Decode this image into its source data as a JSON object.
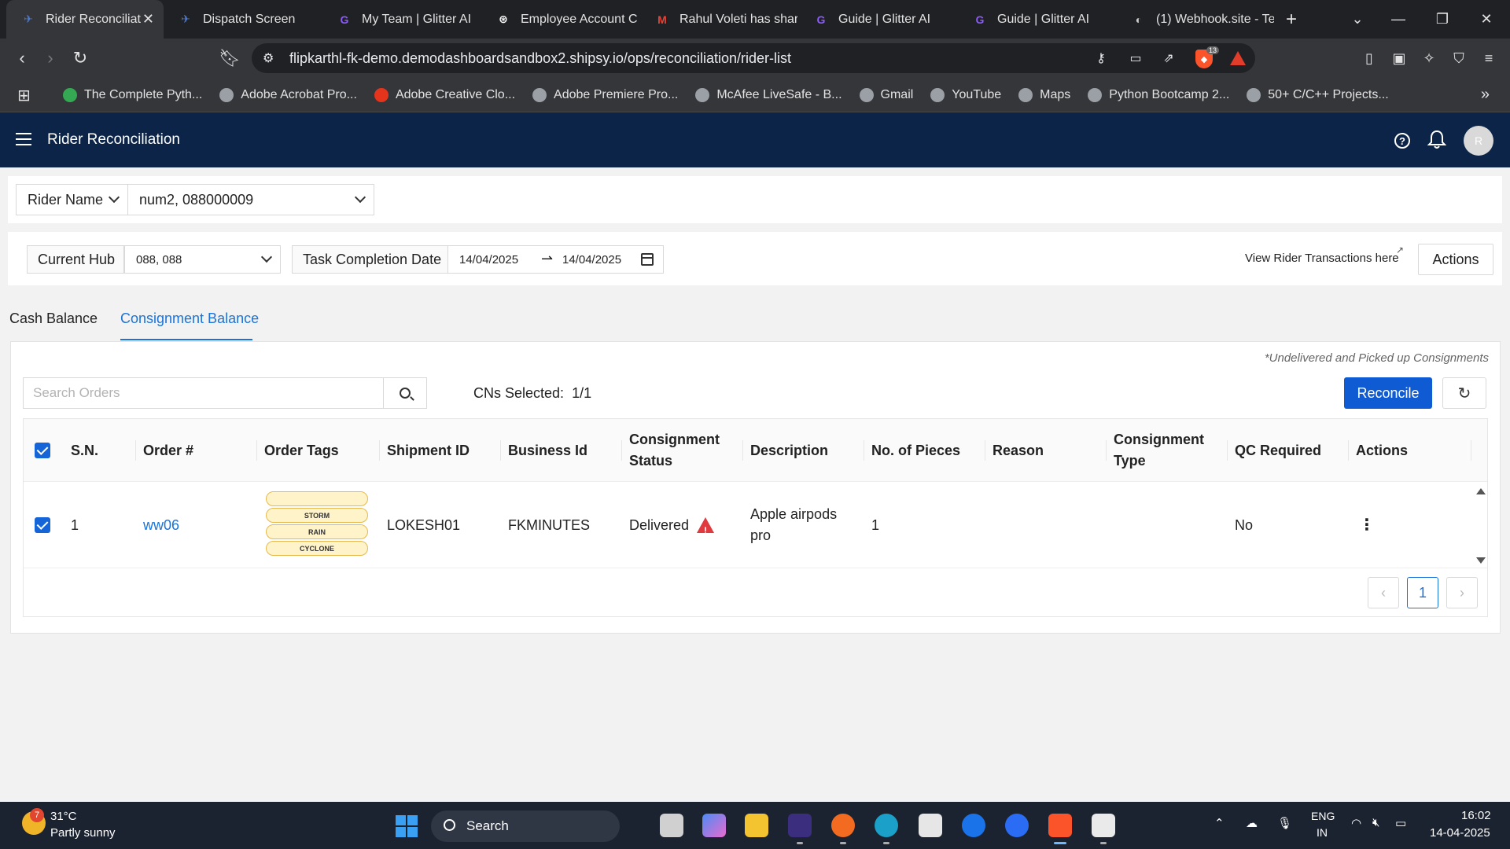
{
  "browser": {
    "tabs": [
      {
        "label": "Rider Reconciliat",
        "icon": "shipsy-icon",
        "active": true
      },
      {
        "label": "Dispatch Screen",
        "icon": "shipsy-icon"
      },
      {
        "label": "My Team | Glitter AI",
        "icon": "glitter-icon"
      },
      {
        "label": "Employee Account C",
        "icon": "chatgpt-icon"
      },
      {
        "label": "Rahul Voleti has shar",
        "icon": "gmail-icon"
      },
      {
        "label": "Guide | Glitter AI",
        "icon": "glitter-icon"
      },
      {
        "label": "Guide | Glitter AI",
        "icon": "glitter-icon"
      },
      {
        "label": "(1) Webhook.site - Te",
        "icon": "webhook-icon"
      }
    ],
    "url": "flipkarthl-fk-demo.demodashboardsandbox2.shipsy.io/ops/reconciliation/rider-list",
    "shield_count": "13",
    "bookmarks": [
      "The Complete Pyth...",
      "Adobe Acrobat Pro...",
      "Adobe Creative Clo...",
      "Adobe Premiere Pro...",
      "McAfee LiveSafe - B...",
      "Gmail",
      "YouTube",
      "Maps",
      "Python Bootcamp 2...",
      "50+ C/C++ Projects..."
    ]
  },
  "app": {
    "title": "Rider Reconciliation",
    "avatar_initial": "R",
    "header_color": "#0b2447",
    "accent_color": "#1a73d9"
  },
  "rider_filter": {
    "label": "Rider Name",
    "value": "num2, 088000009"
  },
  "filters": {
    "hub_label": "Current Hub",
    "hub_value": "088, 088",
    "date_label": "Task Completion Date",
    "date_from": "14/04/2025",
    "date_to": "14/04/2025",
    "transactions_link": "View Rider Transactions here",
    "actions_button": "Actions"
  },
  "content_tabs": {
    "cash": "Cash Balance",
    "consignment": "Consignment Balance",
    "active": "consignment"
  },
  "consignment": {
    "note": "*Undelivered and Picked up Consignments",
    "search_placeholder": "Search Orders",
    "cn_selected_label": "CNs Selected:",
    "cn_selected_value": "1/1",
    "reconcile_button": "Reconcile",
    "columns": {
      "sn": "S.N.",
      "order": "Order #",
      "tags": "Order Tags",
      "shipment": "Shipment ID",
      "business": "Business Id",
      "status": "Consignment Status",
      "description": "Description",
      "pieces": "No. of Pieces",
      "reason": "Reason",
      "type": "Consignment Type",
      "qc": "QC Required",
      "actions": "Actions"
    },
    "rows": [
      {
        "sn": "1",
        "order": "ww06",
        "tags": [
          "",
          "STORM",
          "RAIN",
          "CYCLONE"
        ],
        "shipment": "LOKESH01",
        "business": "FKMINUTES",
        "status": "Delivered",
        "description": "Apple airpods pro",
        "pieces": "1",
        "reason": "",
        "type": "",
        "qc": "No",
        "actions_icon": "more-vertical-icon"
      }
    ],
    "pagination": {
      "current": "1"
    }
  },
  "taskbar": {
    "weather_badge": "7",
    "temperature": "31°C",
    "weather": "Partly sunny",
    "search": "Search",
    "lang_top": "ENG",
    "lang_bottom": "IN",
    "time": "16:02",
    "date": "14-04-2025"
  }
}
